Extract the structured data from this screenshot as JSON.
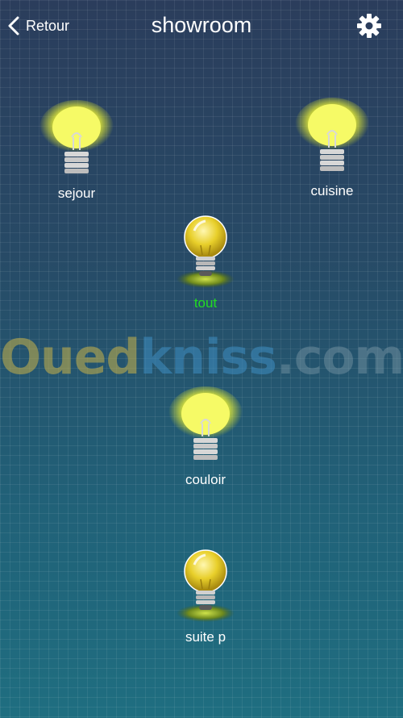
{
  "header": {
    "back_label": "Retour",
    "title": "showroom",
    "settings_icon": "gear-icon"
  },
  "lamps": [
    {
      "label": "sejour",
      "state": "on",
      "label_color": "#ffffff"
    },
    {
      "label": "cuisine",
      "state": "on",
      "label_color": "#ffffff"
    },
    {
      "label": "tout",
      "state": "off",
      "label_color": "#22dd22"
    },
    {
      "label": "couloir",
      "state": "on",
      "label_color": "#ffffff"
    },
    {
      "label": "suite p",
      "state": "off",
      "label_color": "#ffffff"
    }
  ],
  "watermark": {
    "part1": "Oued",
    "part2": "kniss",
    "part3": ".com"
  }
}
